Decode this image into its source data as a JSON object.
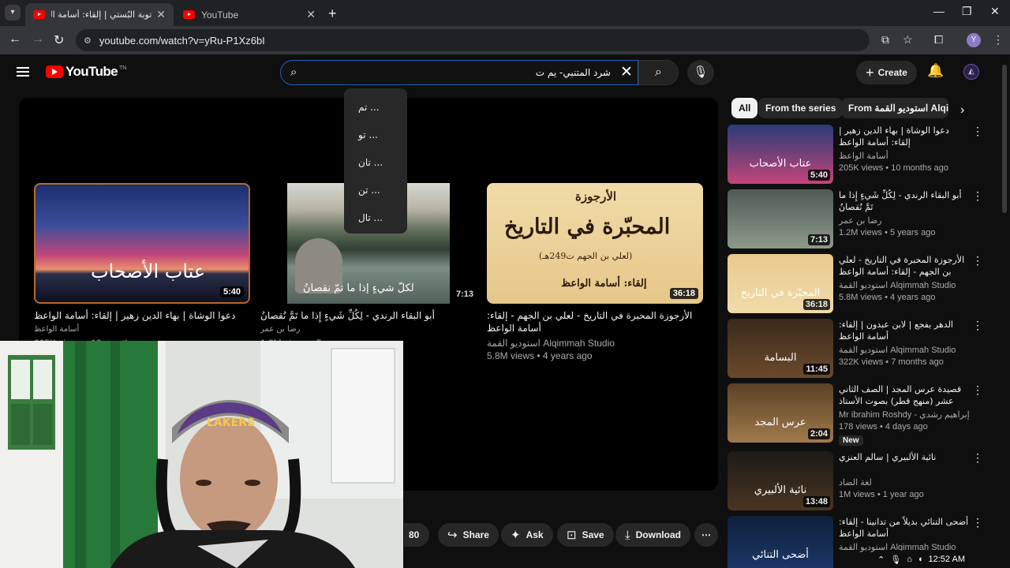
{
  "browser": {
    "tabs": [
      {
        "title": "توبة البُستي | إلقاء: أسامة الواعظ",
        "active": true
      },
      {
        "title": "YouTube",
        "active": false
      }
    ],
    "new_tab": "+",
    "url": "youtube.com/watch?v=yRu-P1Xz6bI",
    "profile_initial": "Y"
  },
  "header": {
    "logo": "YouTube",
    "logo_tm": "TN",
    "search_value": "شرد المتنبي- يم ت",
    "create_label": "Create"
  },
  "suggestions": [
    "تم ...",
    "تو ...",
    "تان ...",
    "تن ...",
    "تال ..."
  ],
  "end_screen": [
    {
      "title": "دعوا الوشاة | بهاء الدين زهير | إلقاء: أسامة الواعظ",
      "channel": "أسامة الواعظ",
      "stats": "205K views • 10 months ago",
      "duration": "5:40",
      "art": "عتاب الأصحاب",
      "colors": [
        "#2a3b78",
        "#c2457a"
      ]
    },
    {
      "title": "أبو البقاء الرندي - لِكُلِّ شَيءٍ إِذا ما تَمَّ نُقصانُ",
      "channel": "رضا بن عمر",
      "stats": "1.2M views • 5 years ago",
      "duration": "7:13",
      "art": "لكلّ شيءٍ إذا ما تمّ نقصانُ",
      "colors": [
        "#4f5a56",
        "#7d8b7e"
      ]
    },
    {
      "title": "الأرجوزة المحبرة في التاريخ - لعلي بن الجهم - إلقاء: أسامة الواعظ",
      "channel": "استوديو القمة Alqimmah Studio",
      "stats": "5.8M views • 4 years ago",
      "duration": "36:18",
      "art_top": "الأرجوزة",
      "art_main": "المحبّرة في التاريخ",
      "art_sub": "(لعلي بن الجهم ت249هـ)",
      "art_bottom": "إلقاء: أسامة الواعظ",
      "colors": [
        "#e8c98c",
        "#f1dcab"
      ]
    }
  ],
  "actions": {
    "likes": "80",
    "share": "Share",
    "ask": "Ask",
    "save": "Save",
    "download": "Download",
    "more": "⋯"
  },
  "chips": [
    "All",
    "From the series",
    "From استوديو القمة Alqimmah"
  ],
  "recommendations": [
    {
      "title": "دعوا الوشاة | بهاء الدين زهير | إلقاء: أسامة الواعظ",
      "channel": "أسامة الواعظ",
      "stats": "205K views • 10 months ago",
      "duration": "5:40",
      "art": "عتاب الأصحاب",
      "colors": [
        "#2a3b78",
        "#c2457a"
      ],
      "is_new": false
    },
    {
      "title": "أبو البقاء الرندي - لِكُلِّ شَيءٍ إِذا ما تَمَّ نُقصانُ",
      "channel": "رضا بن عمر",
      "stats": "1.2M views • 5 years ago",
      "duration": "7:13",
      "art": "",
      "colors": [
        "#4f5a56",
        "#8d9a8a"
      ],
      "is_new": false
    },
    {
      "title": "الأرجوزة المحبرة في التاريخ - لعلي بن الجهم - إلقاء: أسامة الواعظ",
      "channel": "استوديو القمة Alqimmah Studio",
      "stats": "5.8M views • 4 years ago",
      "duration": "36:18",
      "art": "المحبّرة في التاريخ",
      "colors": [
        "#e8c98c",
        "#f1dcab"
      ],
      "is_new": false
    },
    {
      "title": "الدهر يفجع | لابن عبدون | إلقاء: أسامة الواعظ",
      "channel": "استوديو القمة Alqimmah Studio",
      "stats": "322K views • 7 months ago",
      "duration": "11:45",
      "art": "البسامة",
      "colors": [
        "#3a2a1c",
        "#6b4a2c"
      ],
      "is_new": false
    },
    {
      "title": "قصيدة عرس المجد | الصف الثاني عشر (منهج قطر) بصوت الأستاذ إبراهيم رشدي",
      "channel": "Mr ibrahim Roshdy - إبراهيم رشدي",
      "stats": "178 views • 4 days ago",
      "duration": "2:04",
      "art": "عرس المجد",
      "colors": [
        "#5a4126",
        "#a07a4c"
      ],
      "is_new": true,
      "new_label": "New"
    },
    {
      "title": "نائية الألبيري | سالم العنزي",
      "channel": "لغة الضاد",
      "stats": "1M views • 1 year ago",
      "duration": "13:48",
      "art": "نائية الألبيري",
      "colors": [
        "#1c1a18",
        "#4a3520"
      ],
      "is_new": false
    },
    {
      "title": "أضحى التنائي بديلاً من تدانينا - إلقاء: أسامة الواعظ",
      "channel": "استوديو القمة Alqimmah Studio",
      "stats": "",
      "duration": "",
      "art": "أضحى التنائي",
      "colors": [
        "#0e1f3c",
        "#1d3a6a"
      ],
      "is_new": false
    }
  ],
  "tray": {
    "time": "12:52 AM"
  }
}
